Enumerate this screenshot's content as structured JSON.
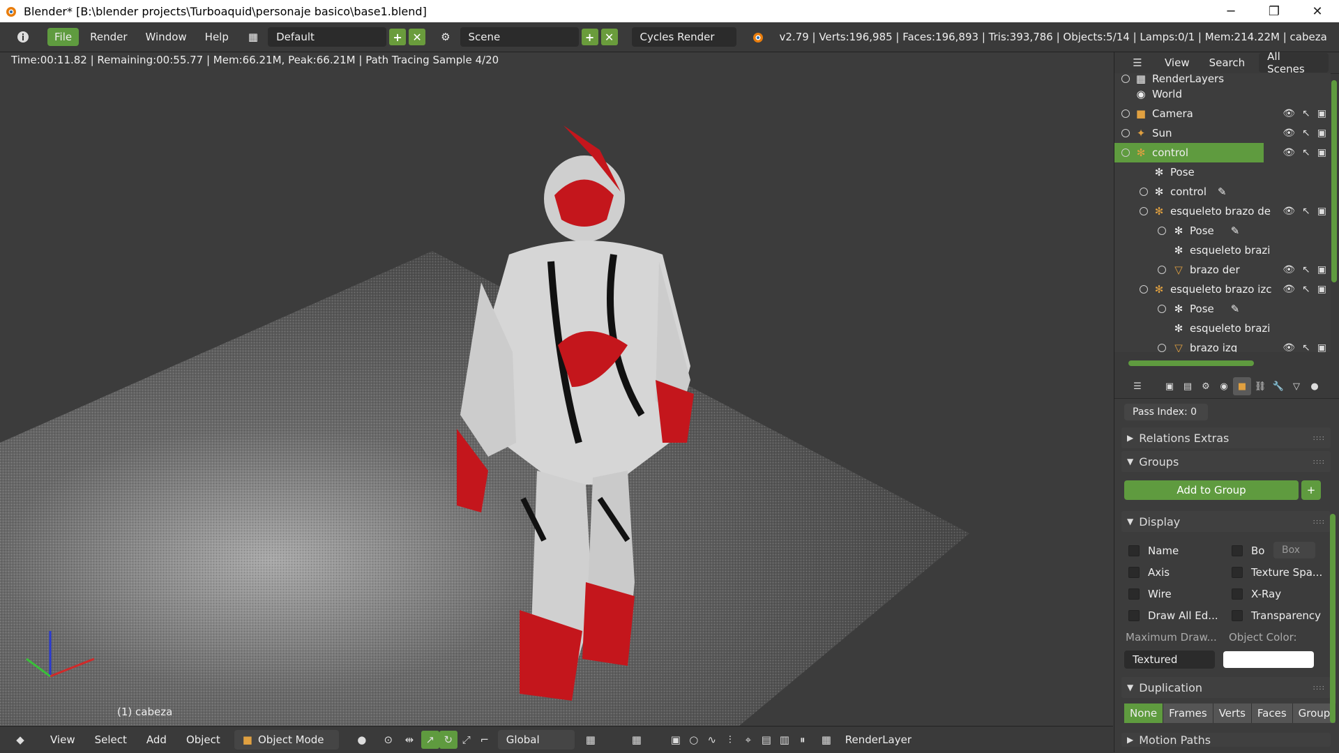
{
  "window": {
    "title": "Blender* [B:\\blender projects\\Turboaquid\\personaje basico\\base1.blend]",
    "minimize": "─",
    "restore": "❐",
    "close": "✕"
  },
  "menu": {
    "info_icon": "info-icon",
    "items": [
      "File",
      "Render",
      "Window",
      "Help"
    ],
    "layout": "Default",
    "scene": "Scene",
    "engine": "Cycles Render",
    "stats": "v2.79 | Verts:196,985 | Faces:196,893 | Tris:393,786 | Objects:5/14 | Lamps:0/1 | Mem:214.22M | cabeza"
  },
  "viewport": {
    "status": "Time:00:11.82 | Remaining:00:55.77 | Mem:66.21M, Peak:66.21M | Path Tracing Sample 4/20",
    "object_label": "(1) cabeza"
  },
  "bottombar": {
    "items": [
      "View",
      "Select",
      "Add",
      "Object"
    ],
    "mode": "Object Mode",
    "orientation": "Global",
    "render_layer": "RenderLayer"
  },
  "outliner": {
    "header": [
      "View",
      "Search",
      "All Scenes"
    ],
    "rows": [
      {
        "label": "RenderLayers"
      },
      {
        "label": "World"
      },
      {
        "label": "Camera"
      },
      {
        "label": "Sun"
      },
      {
        "label": "control"
      },
      {
        "label": "Pose"
      },
      {
        "label": "control"
      },
      {
        "label": "esqueleto brazo de"
      },
      {
        "label": "Pose"
      },
      {
        "label": "esqueleto brazi"
      },
      {
        "label": "brazo der"
      },
      {
        "label": "esqueleto brazo izc"
      },
      {
        "label": "Pose"
      },
      {
        "label": "esqueleto brazi"
      },
      {
        "label": "brazo izq"
      }
    ]
  },
  "properties": {
    "pass_index": "Pass Index: 0",
    "relations_extras": "Relations Extras",
    "groups": "Groups",
    "add_to_group": "Add to Group",
    "display": "Display",
    "name": "Name",
    "bo": "Bo",
    "box": "Box",
    "axis": "Axis",
    "texture_space": "Texture Spa...",
    "wire": "Wire",
    "xray": "X-Ray",
    "draw_all_edges": "Draw All Ed...",
    "transparency": "Transparency",
    "max_draw": "Maximum Draw...",
    "object_color": "Object Color:",
    "textured": "Textured",
    "duplication": "Duplication",
    "dup_options": [
      "None",
      "Frames",
      "Verts",
      "Faces",
      "Group"
    ],
    "motion_paths": "Motion Paths"
  },
  "colors": {
    "accent": "#5f9b3f",
    "header": "#3a3a3a"
  }
}
